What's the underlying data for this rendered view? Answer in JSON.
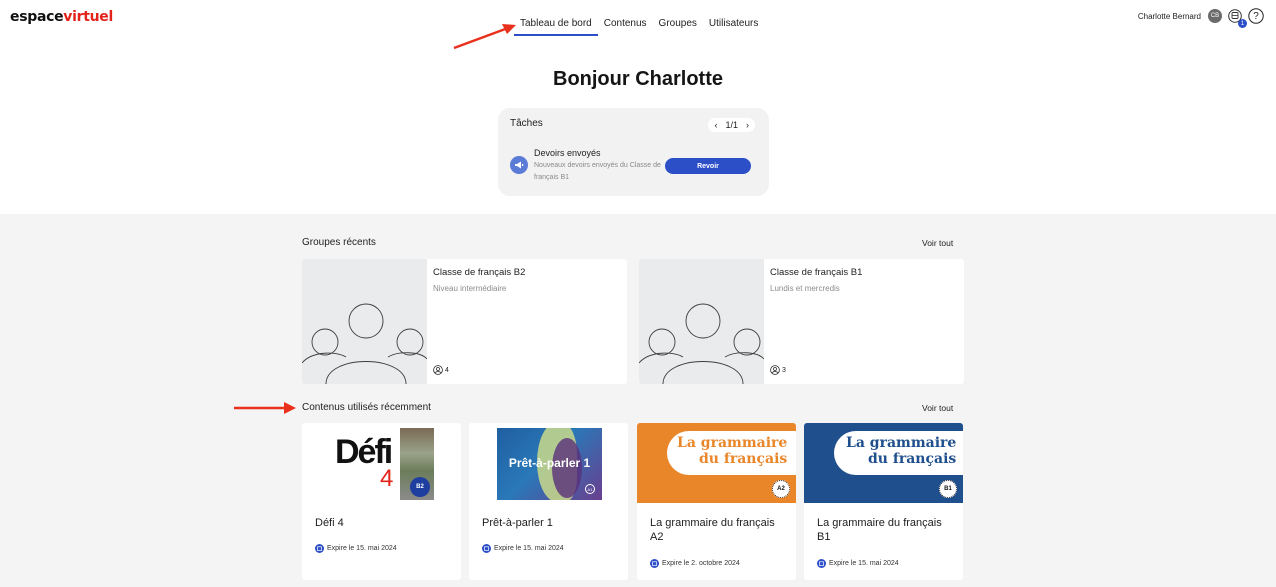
{
  "app": {
    "logo_part1": "espace",
    "logo_part2": "virtuel"
  },
  "nav": {
    "items": [
      "Tableau de bord",
      "Contenus",
      "Groupes",
      "Utilisateurs"
    ],
    "active": 0
  },
  "user": {
    "name": "Charlotte Bernard",
    "initials": "CB",
    "notification_count": "1",
    "help": "?"
  },
  "greeting": "Bonjour Charlotte",
  "tasks": {
    "title": "Tâches",
    "pager": "1/1",
    "item": {
      "title": "Devoirs envoyés",
      "subtitle": "Nouveaux devoirs envoyés du Classe de français B1",
      "button": "Revoir"
    }
  },
  "recent_groups": {
    "title": "Groupes récents",
    "see_all": "Voir tout",
    "items": [
      {
        "name": "Classe de français B2",
        "description": "Niveau intermédiaire",
        "count": "4"
      },
      {
        "name": "Classe de français B1",
        "description": "Lundis et mercredis",
        "count": "3"
      }
    ]
  },
  "recent_contents": {
    "title": "Contenus utilisés récemment",
    "see_all": "Voir tout",
    "items": [
      {
        "title": "Défi 4",
        "cover_title": "Défi",
        "cover_number": "4",
        "level": "B2",
        "expire": "Expire le 15. mai 2024"
      },
      {
        "title": "Prêt-à-parler 1",
        "cover_title": "Prêt-à-parler 1",
        "level": "A1",
        "expire": "Expire le 15. mai 2024"
      },
      {
        "title": "La grammaire du français A2",
        "cover_line1": "La grammaire",
        "cover_line2": "du français",
        "level": "A2",
        "expire": "Expire le 2. octobre 2024"
      },
      {
        "title": "La grammaire du français B1",
        "cover_line1": "La grammaire",
        "cover_line2": "du français",
        "level": "B1",
        "expire": "Expire le 15. mai 2024"
      }
    ]
  },
  "colors": {
    "accent": "#2c4fc8",
    "logo_red": "#e2231a",
    "annotation_arrow": "#e8301c",
    "orange_cover": "#e9862a",
    "blue_cover": "#1f4f8c"
  }
}
